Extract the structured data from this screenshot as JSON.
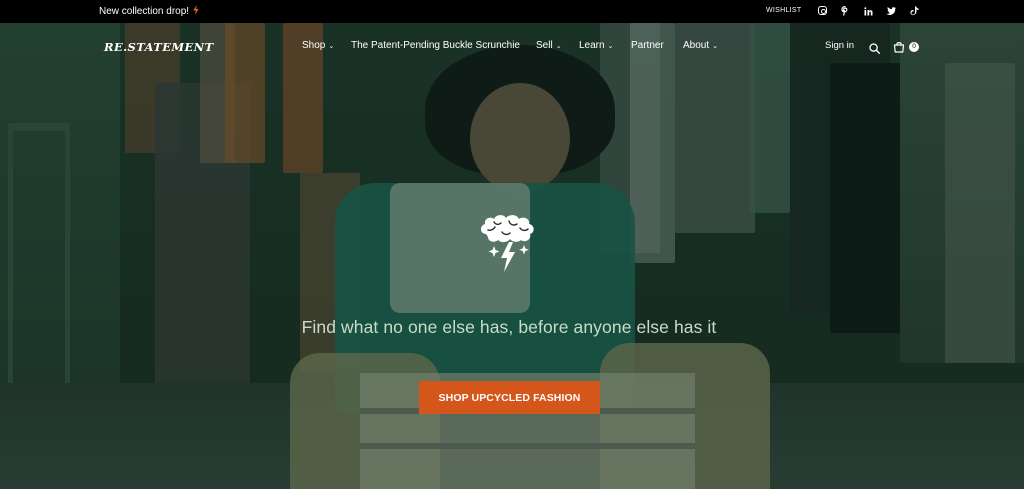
{
  "announcement": {
    "text": "New collection drop!",
    "icon": "lightning-bolt-icon"
  },
  "topbar": {
    "wishlist_label": "WISHLIST",
    "socials": [
      "instagram-icon",
      "pinterest-icon",
      "linkedin-icon",
      "twitter-icon",
      "tiktok-icon"
    ]
  },
  "header": {
    "logo": "RE.STATEMENT",
    "nav": [
      {
        "label": "Shop",
        "has_dropdown": true
      },
      {
        "label": "The Patent-Pending Buckle Scrunchie",
        "has_dropdown": false
      },
      {
        "label": "Sell",
        "has_dropdown": true
      },
      {
        "label": "Learn",
        "has_dropdown": true
      },
      {
        "label": "Partner",
        "has_dropdown": false
      },
      {
        "label": "About",
        "has_dropdown": true
      }
    ],
    "signin_label": "Sign in",
    "cart_count": "0"
  },
  "hero": {
    "tagline": "Find what no one else has, before anyone else has it",
    "cta_label": "SHOP UPCYCLED FASHION"
  },
  "colors": {
    "accent": "#d4561a",
    "topbar_bg": "#000000",
    "tagline": "#c9dcc8",
    "hero_tint": "#1d3025"
  }
}
